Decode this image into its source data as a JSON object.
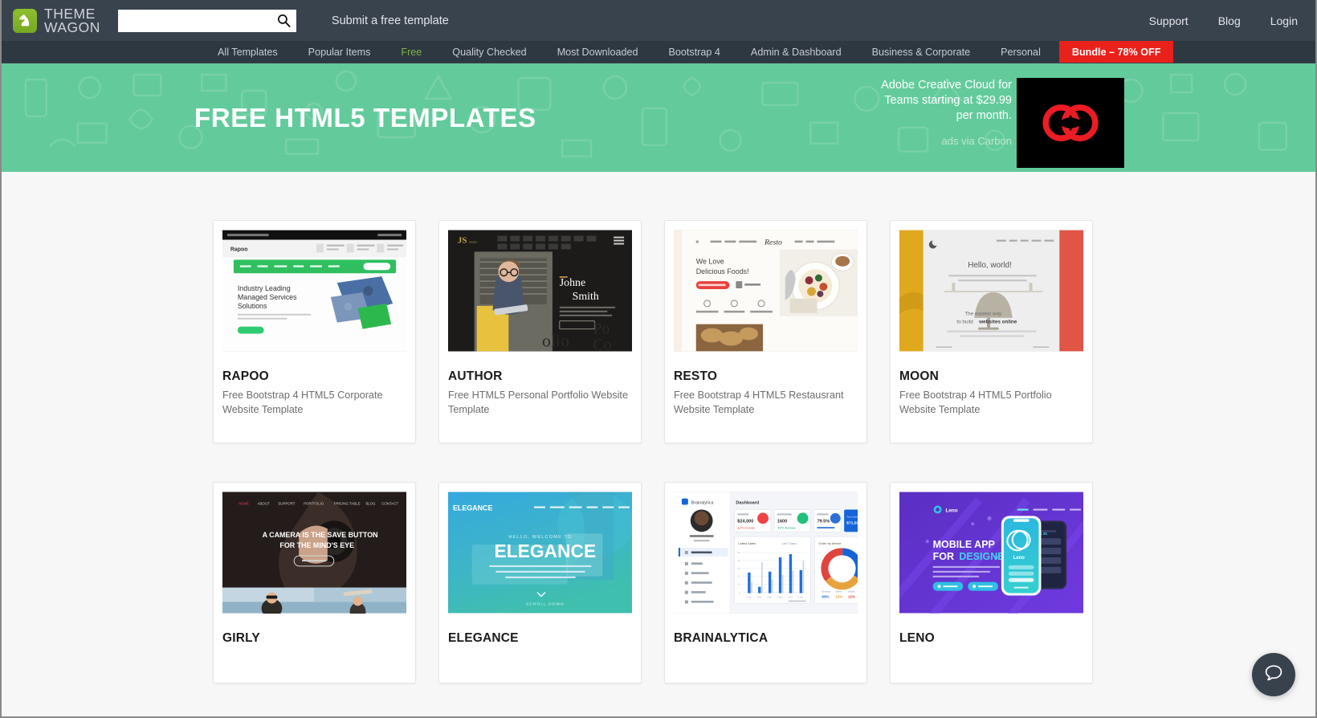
{
  "header": {
    "brand_line1": "THEME",
    "brand_line2": "WAGON",
    "logo_icon": "knight-chess-logo",
    "search_placeholder": "",
    "search_value": "",
    "search_icon": "search-icon",
    "submit_label": "Submit a free template",
    "links": [
      {
        "label": "Support"
      },
      {
        "label": "Blog"
      },
      {
        "label": "Login"
      }
    ]
  },
  "nav": {
    "items": [
      {
        "label": "All Templates",
        "active": false
      },
      {
        "label": "Popular Items",
        "active": false
      },
      {
        "label": "Free",
        "active": true
      },
      {
        "label": "Quality Checked",
        "active": false
      },
      {
        "label": "Most Downloaded",
        "active": false
      },
      {
        "label": "Bootstrap 4",
        "active": false
      },
      {
        "label": "Admin & Dashboard",
        "active": false
      },
      {
        "label": "Business & Corporate",
        "active": false
      },
      {
        "label": "Personal",
        "active": false
      }
    ],
    "bundle_label": "Bundle – 78% OFF",
    "active_color": "#7fb442",
    "bundle_color": "#e8221b"
  },
  "hero": {
    "title": "FREE HTML5 TEMPLATES",
    "bg_color": "#63cb9b",
    "ad": {
      "line1": "Adobe Creative Cloud for",
      "line2": "Teams starting at $29.99",
      "line3": "per month.",
      "via": "ads via Carbon",
      "image_alt": "adobe-creative-cloud-logo"
    }
  },
  "templates": {
    "row1": [
      {
        "name": "RAPOO",
        "description": "Free Bootstrap 4 HTML5 Corporate Website Template",
        "thumb": "rapoo-preview",
        "thumb_headline": "Industry Leading Managed Services Solutions",
        "thumb_brand": "Rapoo",
        "accent": "#2ecc71"
      },
      {
        "name": "AUTHOR",
        "description": "Free HTML5 Personal Portfolio Website Template",
        "thumb": "author-preview",
        "thumb_headline": "Johne Smith",
        "thumb_brand": "JS",
        "accent": "#c9a44c"
      },
      {
        "name": "RESTO",
        "description": "Free Bootstrap 4 HTML5 Restausrant Website Template",
        "thumb": "resto-preview",
        "thumb_headline": "We Love Delicious Foods!",
        "thumb_brand": "Resto",
        "accent": "#e8413c"
      },
      {
        "name": "MOON",
        "description": "Free Bootstrap 4 HTML5 Portfolio Website Template",
        "thumb": "moon-preview",
        "thumb_headline": "Hello, world!",
        "thumb_sub": "The easiest way to build websites online",
        "accent": "#e0a81d"
      }
    ],
    "row2": [
      {
        "name": "GIRLY",
        "description": "",
        "thumb": "girly-preview",
        "thumb_headline": "A CAMERA IS THE SAVE BUTTON FOR THE MIND'S EYE",
        "accent": "#e23a5e"
      },
      {
        "name": "ELEGANCE",
        "description": "",
        "thumb": "elegance-preview",
        "thumb_headline": "ELEGANCE",
        "thumb_sub": "HELLO, WELCOME TO",
        "thumb_scroll": "SCROLL DOWN",
        "accent": "#2aa3d6"
      },
      {
        "name": "BRAINALYTICA",
        "description": "",
        "thumb": "brainalytica-preview",
        "thumb_brand": "Brainalytica",
        "thumb_headline": "Dashboard",
        "stats": [
          "$24,000",
          "1600",
          "79.5%"
        ],
        "accent": "#1565d8"
      },
      {
        "name": "LENO",
        "description": "",
        "thumb": "leno-preview",
        "thumb_headline": "MOBILE APP FOR DESIGNERS",
        "thumb_brand": "Leno",
        "accent": "#5b34c6"
      }
    ]
  },
  "chat": {
    "icon": "chat-bubble-icon",
    "color": "#38424d"
  }
}
